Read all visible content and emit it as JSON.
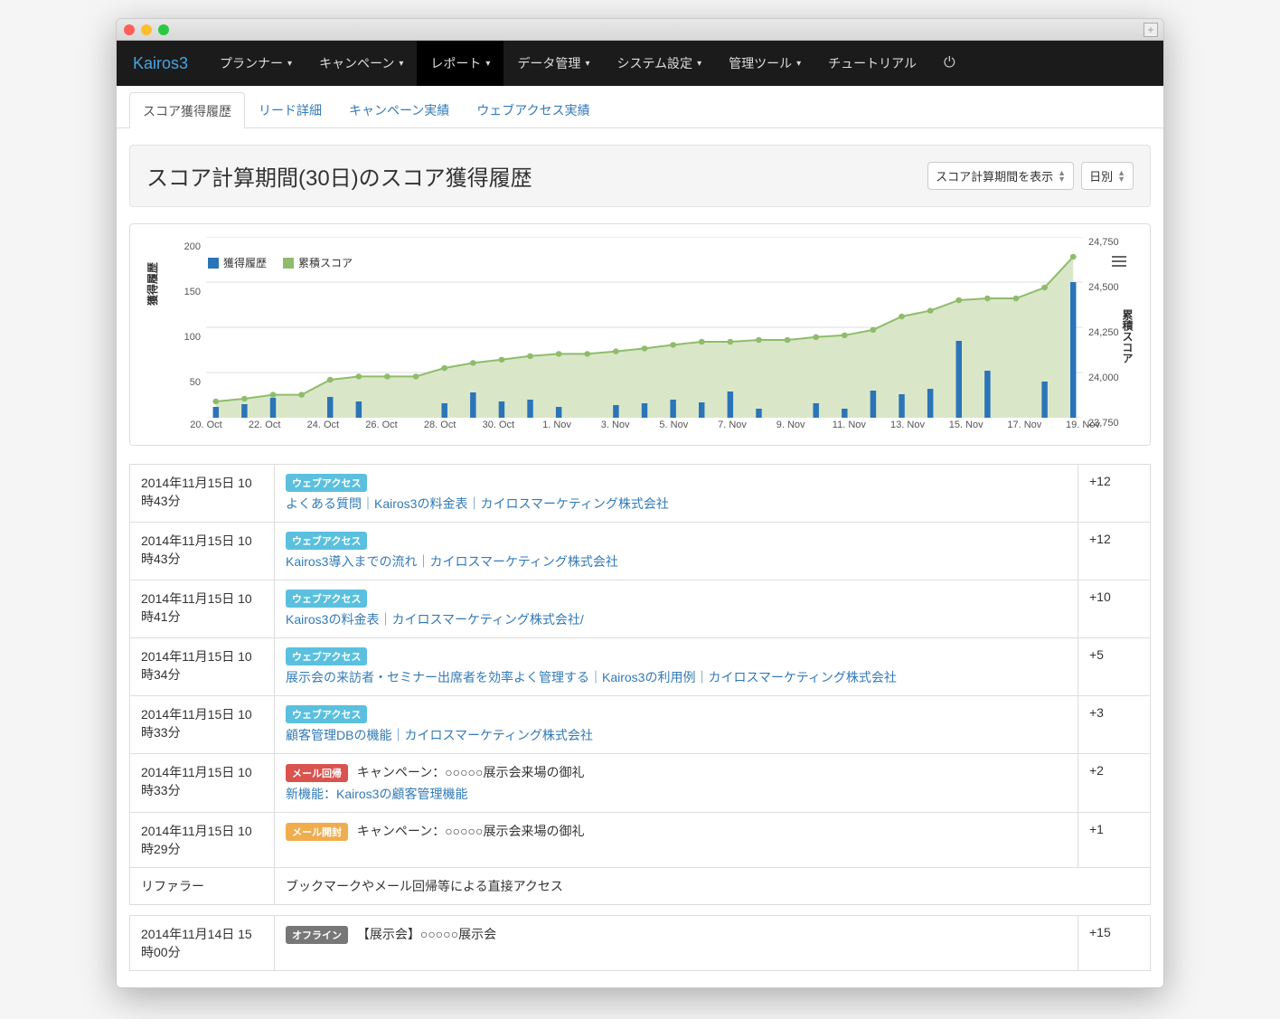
{
  "brand": "Kairos3",
  "topnav": [
    {
      "label": "プランナー",
      "caret": true
    },
    {
      "label": "キャンペーン",
      "caret": true
    },
    {
      "label": "レポート",
      "caret": true,
      "active": true
    },
    {
      "label": "データ管理",
      "caret": true
    },
    {
      "label": "システム設定",
      "caret": true
    },
    {
      "label": "管理ツール",
      "caret": true
    },
    {
      "label": "チュートリアル",
      "caret": false
    }
  ],
  "tabs": [
    {
      "label": "スコア獲得履歴",
      "active": true
    },
    {
      "label": "リード詳細"
    },
    {
      "label": "キャンペーン実績"
    },
    {
      "label": "ウェブアクセス実績"
    }
  ],
  "page_title": "スコア計算期間(30日)のスコア獲得履歴",
  "select_period": "スコア計算期間を表示",
  "select_granularity": "日別",
  "chart": {
    "legend": {
      "bar": "獲得履歴",
      "area": "累積スコア"
    },
    "ylabel_left": "獲得履歴",
    "ylabel_right": "累積スコア",
    "yticks_left": [
      "200",
      "150",
      "100",
      "50"
    ],
    "yticks_right": [
      "24,750",
      "24,500",
      "24,250",
      "24,000",
      "23,750"
    ],
    "xticks": [
      "20. Oct",
      "22. Oct",
      "24. Oct",
      "26. Oct",
      "28. Oct",
      "30. Oct",
      "1. Nov",
      "3. Nov",
      "5. Nov",
      "7. Nov",
      "9. Nov",
      "11. Nov",
      "13. Nov",
      "15. Nov",
      "17. Nov",
      "19. Nov"
    ]
  },
  "badges": {
    "web": "ウェブアクセス",
    "mail_return": "メール回帰",
    "mail_open": "メール開封",
    "offline": "オフライン"
  },
  "referrer_label": "リファラー",
  "rows": [
    {
      "date": "2014年11月15日 10時43分",
      "badge": "web",
      "link": "よくある質問｜Kairos3の料金表｜カイロスマーケティング株式会社",
      "score": "+12"
    },
    {
      "date": "2014年11月15日 10時43分",
      "badge": "web",
      "link": "Kairos3導入までの流れ｜カイロスマーケティング株式会社",
      "score": "+12"
    },
    {
      "date": "2014年11月15日 10時41分",
      "badge": "web",
      "link": "Kairos3の料金表｜カイロスマーケティング株式会社/",
      "score": "+10"
    },
    {
      "date": "2014年11月15日 10時34分",
      "badge": "web",
      "link": "展示会の来訪者・セミナー出席者を効率よく管理する｜Kairos3の利用例｜カイロスマーケティング株式会社",
      "score": "+5"
    },
    {
      "date": "2014年11月15日 10時33分",
      "badge": "web",
      "link": "顧客管理DBの機能｜カイロスマーケティング株式会社",
      "score": "+3"
    },
    {
      "date": "2014年11月15日 10時33分",
      "badge": "mail_return",
      "after": " キャンペーン：○○○○○展示会来場の御礼",
      "link": "新機能：Kairos3の顧客管理機能",
      "score": "+2"
    },
    {
      "date": "2014年11月15日 10時29分",
      "badge": "mail_open",
      "after": " キャンペーン：○○○○○展示会来場の御礼",
      "score": "+1"
    },
    {
      "date": "リファラー",
      "plain": "ブックマークやメール回帰等による直接アクセス"
    }
  ],
  "rows2": [
    {
      "date": "2014年11月14日 15時00分",
      "badge": "offline",
      "after": " 【展示会】○○○○○展示会",
      "score": "+15"
    }
  ],
  "chart_data": {
    "type": "bar+line",
    "x": [
      "20. Oct",
      "21. Oct",
      "22. Oct",
      "23. Oct",
      "24. Oct",
      "25. Oct",
      "26. Oct",
      "27. Oct",
      "28. Oct",
      "29. Oct",
      "30. Oct",
      "31. Oct",
      "1. Nov",
      "2. Nov",
      "3. Nov",
      "4. Nov",
      "5. Nov",
      "6. Nov",
      "7. Nov",
      "8. Nov",
      "9. Nov",
      "10. Nov",
      "11. Nov",
      "12. Nov",
      "13. Nov",
      "14. Nov",
      "15. Nov",
      "16. Nov",
      "17. Nov",
      "18. Nov",
      "19. Nov"
    ],
    "series": [
      {
        "name": "獲得履歴",
        "type": "bar",
        "axis": "left",
        "values": [
          12,
          15,
          22,
          0,
          23,
          18,
          0,
          0,
          16,
          28,
          18,
          20,
          12,
          0,
          14,
          16,
          20,
          17,
          29,
          10,
          0,
          16,
          10,
          30,
          26,
          32,
          85,
          52,
          0,
          40,
          150
        ]
      },
      {
        "name": "累積スコア",
        "type": "line-area",
        "axis": "right",
        "values": [
          23840,
          23855,
          23877,
          23877,
          23960,
          23978,
          23978,
          23978,
          24025,
          24053,
          24071,
          24091,
          24103,
          24103,
          24117,
          24133,
          24153,
          24170,
          24170,
          24180,
          24180,
          24196,
          24206,
          24236,
          24310,
          24342,
          24400,
          24410,
          24410,
          24470,
          24640
        ]
      }
    ],
    "ylabel_left": "獲得履歴",
    "ylabel_right": "累積スコア",
    "ylim_left": [
      0,
      200
    ],
    "ylim_right": [
      23750,
      24750
    ]
  }
}
